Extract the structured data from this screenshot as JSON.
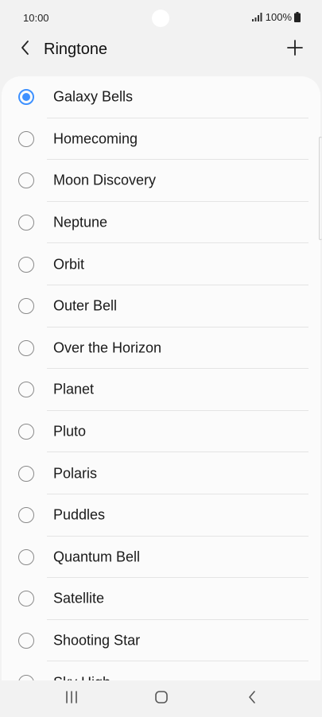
{
  "status_bar": {
    "time": "10:00",
    "battery_text": "100%"
  },
  "app_bar": {
    "title": "Ringtone",
    "back_icon": "chevron-left-icon",
    "add_icon": "plus-icon"
  },
  "ringtones": {
    "selected_index": 0,
    "accent_color": "#3e91ff",
    "items": [
      {
        "label": "Galaxy Bells"
      },
      {
        "label": "Homecoming"
      },
      {
        "label": "Moon Discovery"
      },
      {
        "label": "Neptune"
      },
      {
        "label": "Orbit"
      },
      {
        "label": "Outer Bell"
      },
      {
        "label": "Over the Horizon"
      },
      {
        "label": "Planet"
      },
      {
        "label": "Pluto"
      },
      {
        "label": "Polaris"
      },
      {
        "label": "Puddles"
      },
      {
        "label": "Quantum Bell"
      },
      {
        "label": "Satellite"
      },
      {
        "label": "Shooting Star"
      },
      {
        "label": "Sky High"
      }
    ]
  },
  "nav_bar": {
    "recents_icon": "recents-icon",
    "home_icon": "home-icon",
    "back_icon": "back-icon"
  }
}
